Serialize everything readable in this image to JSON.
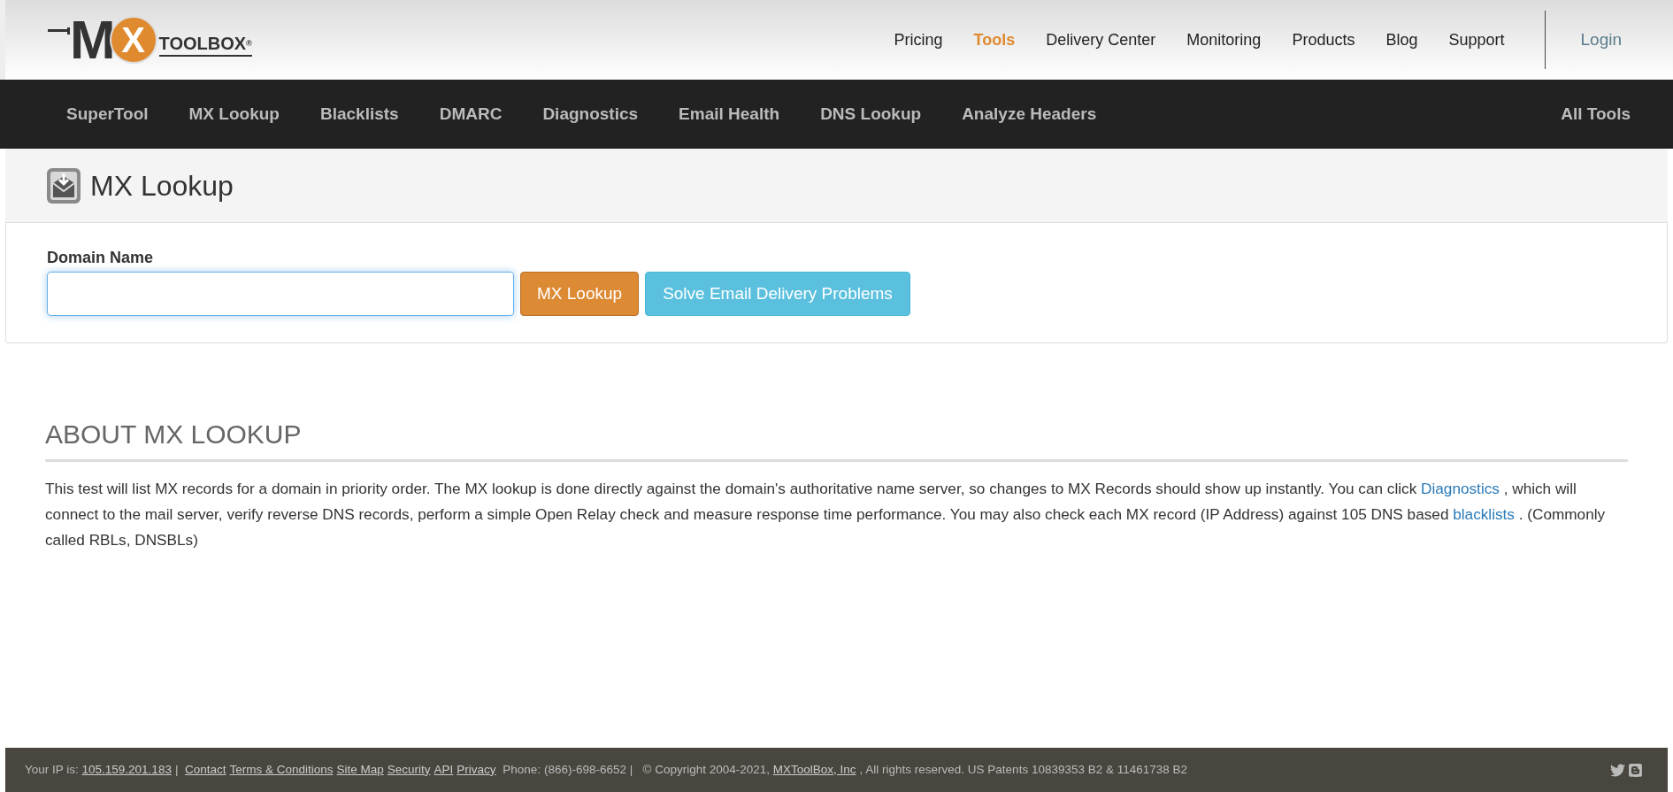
{
  "logo": {
    "letter_1": "M",
    "letter_2": "X",
    "wordmark": "TOOLBOX",
    "mark": "®"
  },
  "top_nav": [
    {
      "label": "Pricing",
      "selected": false
    },
    {
      "label": "Tools",
      "selected": true
    },
    {
      "label": "Delivery Center",
      "selected": false
    },
    {
      "label": "Monitoring",
      "selected": false
    },
    {
      "label": "Products",
      "selected": false
    },
    {
      "label": "Blog",
      "selected": false
    },
    {
      "label": "Support",
      "selected": false
    }
  ],
  "login": "Login",
  "tool_nav": [
    "SuperTool",
    "MX Lookup",
    "Blacklists",
    "DMARC",
    "Diagnostics",
    "Email Health",
    "DNS Lookup",
    "Analyze Headers"
  ],
  "all_tools": "All Tools",
  "page_title": "MX Lookup",
  "form": {
    "label": "Domain Name",
    "focused": true,
    "buttons": [
      {
        "label": "MX Lookup",
        "kind": "primary"
      },
      {
        "label": "Solve Email Delivery Problems",
        "kind": "info"
      }
    ]
  },
  "about": {
    "heading": "ABOUT MX LOOKUP",
    "parts": [
      {
        "kind": "text",
        "text": "This test will list MX records for a domain in priority order. The MX lookup is done directly against the domain's authoritative name server, so changes to MX Records should show up instantly. You can click "
      },
      {
        "kind": "link",
        "text": "Diagnostics"
      },
      {
        "kind": "text",
        "text": " , which will connect to the mail server, verify reverse DNS records, perform a simple Open Relay check and measure response time performance. You may also check each MX record (IP Address) against 105 DNS based "
      },
      {
        "kind": "link",
        "text": "blacklists"
      },
      {
        "kind": "text",
        "text": " . (Commonly called RBLs, DNSBLs)"
      }
    ]
  },
  "footer": {
    "parts": [
      {
        "kind": "text",
        "text": "Your IP is: "
      },
      {
        "kind": "link",
        "text": "105.159.201.183"
      },
      {
        "kind": "text",
        "text": "|  "
      },
      {
        "kind": "link",
        "text": "Contact"
      },
      {
        "kind": "link",
        "text": "Terms & Conditions"
      },
      {
        "kind": "link",
        "text": "Site Map"
      },
      {
        "kind": "link",
        "text": "Security"
      },
      {
        "kind": "link",
        "text": "API"
      },
      {
        "kind": "link",
        "text": "Privacy"
      },
      {
        "kind": "text",
        "text": " Phone: (866)-698-6652 |   © Copyright 2004-2021, "
      },
      {
        "kind": "link",
        "text": "MXToolBox, Inc"
      },
      {
        "kind": "text",
        "text": ", All rights reserved. US Patents 10839353 B2 & 11461738 B2"
      }
    ]
  }
}
